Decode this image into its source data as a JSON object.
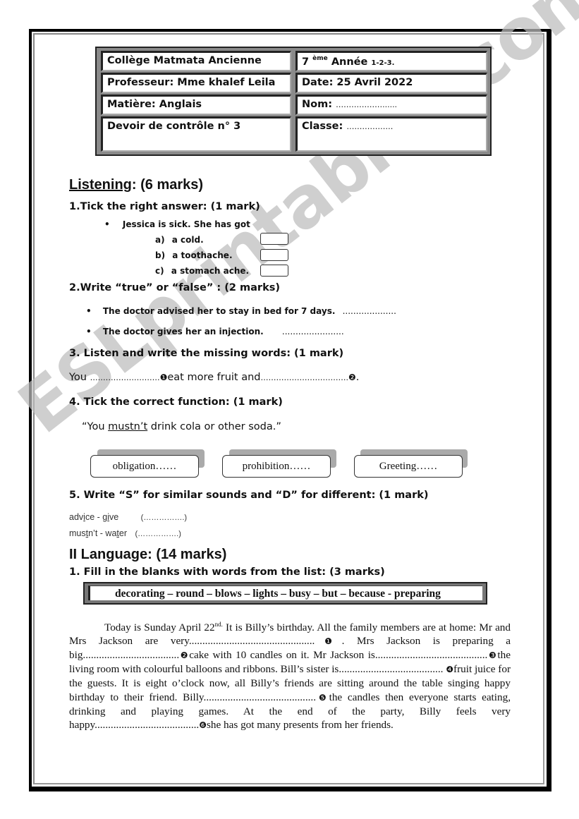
{
  "header": {
    "school": "Collège Matmata Ancienne",
    "grade_num": "7",
    "grade_sup": "ème",
    "grade_label": "Année",
    "grade_classes": "1-2-3.",
    "teacher": "Professeur: Mme khalef Leila",
    "date": "Date: 25 Avril 2022",
    "subject": "Matière: Anglais",
    "name_label": "Nom:",
    "name_value": "………………......",
    "exam": "Devoir de contrôle n° 3",
    "class_label": "Classe:",
    "class_value": "………………"
  },
  "listening": {
    "title": "Listening",
    "marks": ": (6 marks)",
    "q1": {
      "title": "1.Tick the right answer: (1 mark)",
      "stem": "Jessica is sick. She has got",
      "options": [
        {
          "letter": "a)",
          "text": "a cold."
        },
        {
          "letter": "b)",
          "text": "a toothache."
        },
        {
          "letter": "c)",
          "text": "a stomach ache."
        }
      ]
    },
    "q2": {
      "title": "2.Write “true” or “false” : (2 marks)",
      "statements": [
        {
          "text": "The doctor advised her to stay in bed for 7 days.",
          "blank": "...................."
        },
        {
          "text": "The doctor gives her an injection.",
          "blank": "......................."
        }
      ]
    },
    "q3": {
      "title": "3. Listen and write the missing words: (1 mark)",
      "part1": "You ",
      "blank1": "………………………",
      "marker1": "❶",
      "part2": "eat more fruit and",
      "blank2": "…………………………….",
      "marker2": "❷",
      "end": "."
    },
    "q4": {
      "title": "4. Tick the correct function: (1 mark)",
      "quote_open": "“You ",
      "quote_underlined": "mustn’t",
      "quote_rest": " drink cola or other soda.”",
      "choices": [
        "obligation……",
        "prohibition……",
        "Greeting……"
      ]
    },
    "q5": {
      "title": "5. Write “S” for similar sounds and “D” for different: (1 mark)",
      "pairs": [
        {
          "w1a": "adv",
          "w1u": "i",
          "w1b": "ce",
          "sep": " - ",
          "w2a": "g",
          "w2u": "i",
          "w2b": "ve",
          "blank": "(…………….)"
        },
        {
          "w1a": "mus",
          "w1u": "t",
          "w1b": "n’t",
          "sep": " - ",
          "w2a": "wa",
          "w2u": "t",
          "w2b": "er",
          "blank": "(…………….)"
        }
      ]
    }
  },
  "language": {
    "title": "II Language: (14 marks)",
    "q1": {
      "title": "1. Fill in the blanks with words from the list: (3 marks)",
      "word_list": "decorating – round – blows – lights – busy – but – because - preparing",
      "paragraph": {
        "s1": "Today is Sunday April 22",
        "s1_sup": "nd.",
        "s2": " It is Billy’s birthday. All the family members are at home: Mr and Mrs Jackson are very",
        "b1": "...............................................",
        "m1": "❶",
        "s3": ". Mrs Jackson is preparing a big",
        "b2": "....................................",
        "m2": "❷",
        "s4": "cake with 10 candles on it. Mr Jackson is",
        "b3": "..........................................",
        "m3": "❸",
        "s5": "the living room with colourful balloons and ribbons. Bill’s sister is",
        "b4": ".......................................",
        "m4": "❹",
        "s6": "fruit juice for the guests. It is eight o’clock now, all Billy’s friends are sitting around the table singing happy birthday to their friend. Billy",
        "b5": "..........................................",
        "m5": "❺",
        "s7": "the candles then everyone starts eating, drinking and playing games. At the end of the party, Billy feels very happy",
        "b6": ".......................................",
        "m6": "❻",
        "s8": "she has got many presents from her friends."
      }
    }
  },
  "watermark": "ESLprintables.com"
}
